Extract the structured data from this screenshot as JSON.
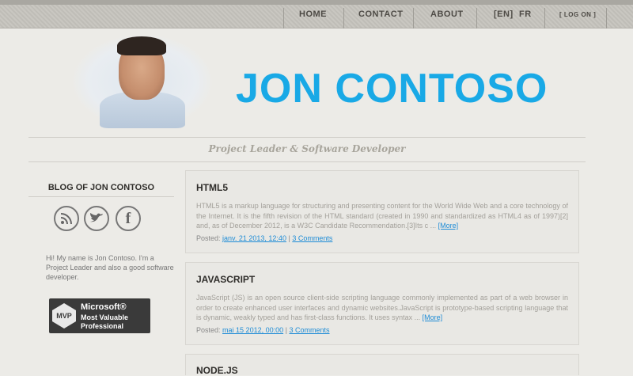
{
  "nav": {
    "home": "HOME",
    "contact": "CONTACT",
    "about": "ABOUT",
    "lang_en": "[EN]",
    "lang_fr": "FR",
    "login": "[ LOG ON ]"
  },
  "header": {
    "name": "JON CONTOSO",
    "tagline": "Project Leader & Software Developer"
  },
  "sidebar": {
    "title": "BLOG OF JON CONTOSO",
    "social": [
      {
        "icon": "rss-icon",
        "glyph": "≈"
      },
      {
        "icon": "twitter-icon",
        "glyph": "🐦"
      },
      {
        "icon": "facebook-icon",
        "glyph": "f"
      }
    ],
    "bio": "Hi! My name is Jon Contoso. I'm a Project Leader and also a good software developer.",
    "mvp_line1": "Microsoft®",
    "mvp_line2": "Most Valuable",
    "mvp_line3": "Professional",
    "mvp_badge": "MVP"
  },
  "posts": [
    {
      "title": "HTML5",
      "excerpt": "HTML5 is a markup language for structuring and presenting content for the World Wide Web and a core technology of the Internet. It is the fifth revision of the HTML standard (created in 1990 and standardized as HTML4 as of 1997)[2] and, as of December 2012, is a W3C Candidate Recommendation.[3]Its c ...",
      "more": "[More]",
      "posted_label": "Posted:",
      "date": "janv. 21 2013, 12:40",
      "comments": "3 Comments"
    },
    {
      "title": "JAVASCRIPT",
      "excerpt": "JavaScript (JS) is an open source client-side scripting language commonly implemented as part of a web browser in order to create enhanced user interfaces and dynamic websites.JavaScript is prototype-based scripting language that is dynamic, weakly typed and has first-class functions. It uses syntax ...",
      "more": "[More]",
      "posted_label": "Posted:",
      "date": "mai 15 2012, 00:00",
      "comments": "3 Comments"
    },
    {
      "title": "NODE.JS"
    }
  ],
  "colors": {
    "accent": "#19a9e6",
    "background": "#ecebe7",
    "link": "#1e8cd6"
  }
}
